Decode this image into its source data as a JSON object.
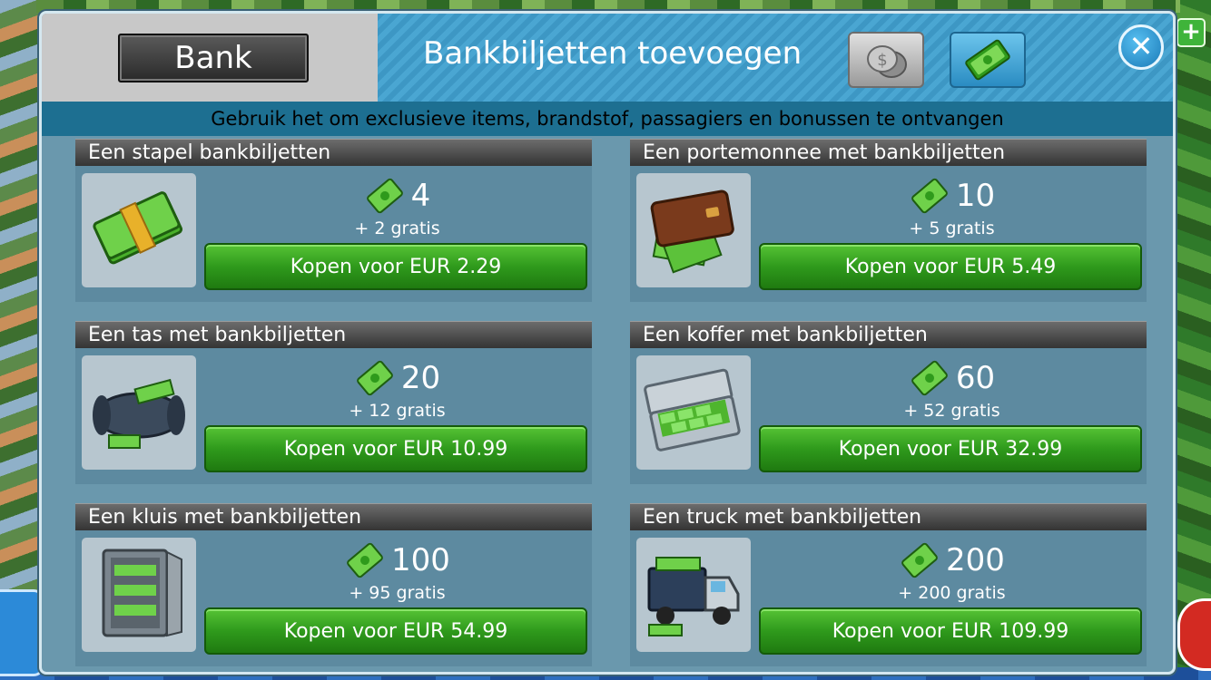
{
  "header": {
    "tab_label": "Bank",
    "title": "Bankbiljetten toevoegen",
    "subtitle": "Gebruik het om exclusieve items, brandstof, passagiers en bonussen te ontvangen",
    "close_symbol": "✕"
  },
  "colors": {
    "panel_bg": "#6a98ad",
    "title_bar": "#3d97c4",
    "subtitle_bar": "#1d6f91",
    "buy_button": "#2f9a1c"
  },
  "icons": [
    "coins-icon",
    "banknotes-icon",
    "close-icon",
    "cash-icon"
  ],
  "offers": [
    {
      "title": "Een stapel bankbiljetten",
      "amount": "4",
      "bonus": "+ 2 gratis",
      "buy_label": "Kopen voor EUR 2.29",
      "image": "stack-of-banknotes"
    },
    {
      "title": "Een portemonnee met bankbiljetten",
      "amount": "10",
      "bonus": "+ 5 gratis",
      "buy_label": "Kopen voor EUR 5.49",
      "image": "wallet-with-banknotes"
    },
    {
      "title": "Een tas met bankbiljetten",
      "amount": "20",
      "bonus": "+ 12 gratis",
      "buy_label": "Kopen voor EUR 10.99",
      "image": "bag-with-banknotes"
    },
    {
      "title": "Een koffer met bankbiljetten",
      "amount": "60",
      "bonus": "+ 52 gratis",
      "buy_label": "Kopen voor EUR 32.99",
      "image": "suitcase-with-banknotes"
    },
    {
      "title": "Een kluis met bankbiljetten",
      "amount": "100",
      "bonus": "+ 95 gratis",
      "buy_label": "Kopen voor EUR 54.99",
      "image": "safe-with-banknotes"
    },
    {
      "title": "Een truck met bankbiljetten",
      "amount": "200",
      "bonus": "+ 200 gratis",
      "buy_label": "Kopen voor EUR 109.99",
      "image": "truck-with-banknotes"
    }
  ]
}
